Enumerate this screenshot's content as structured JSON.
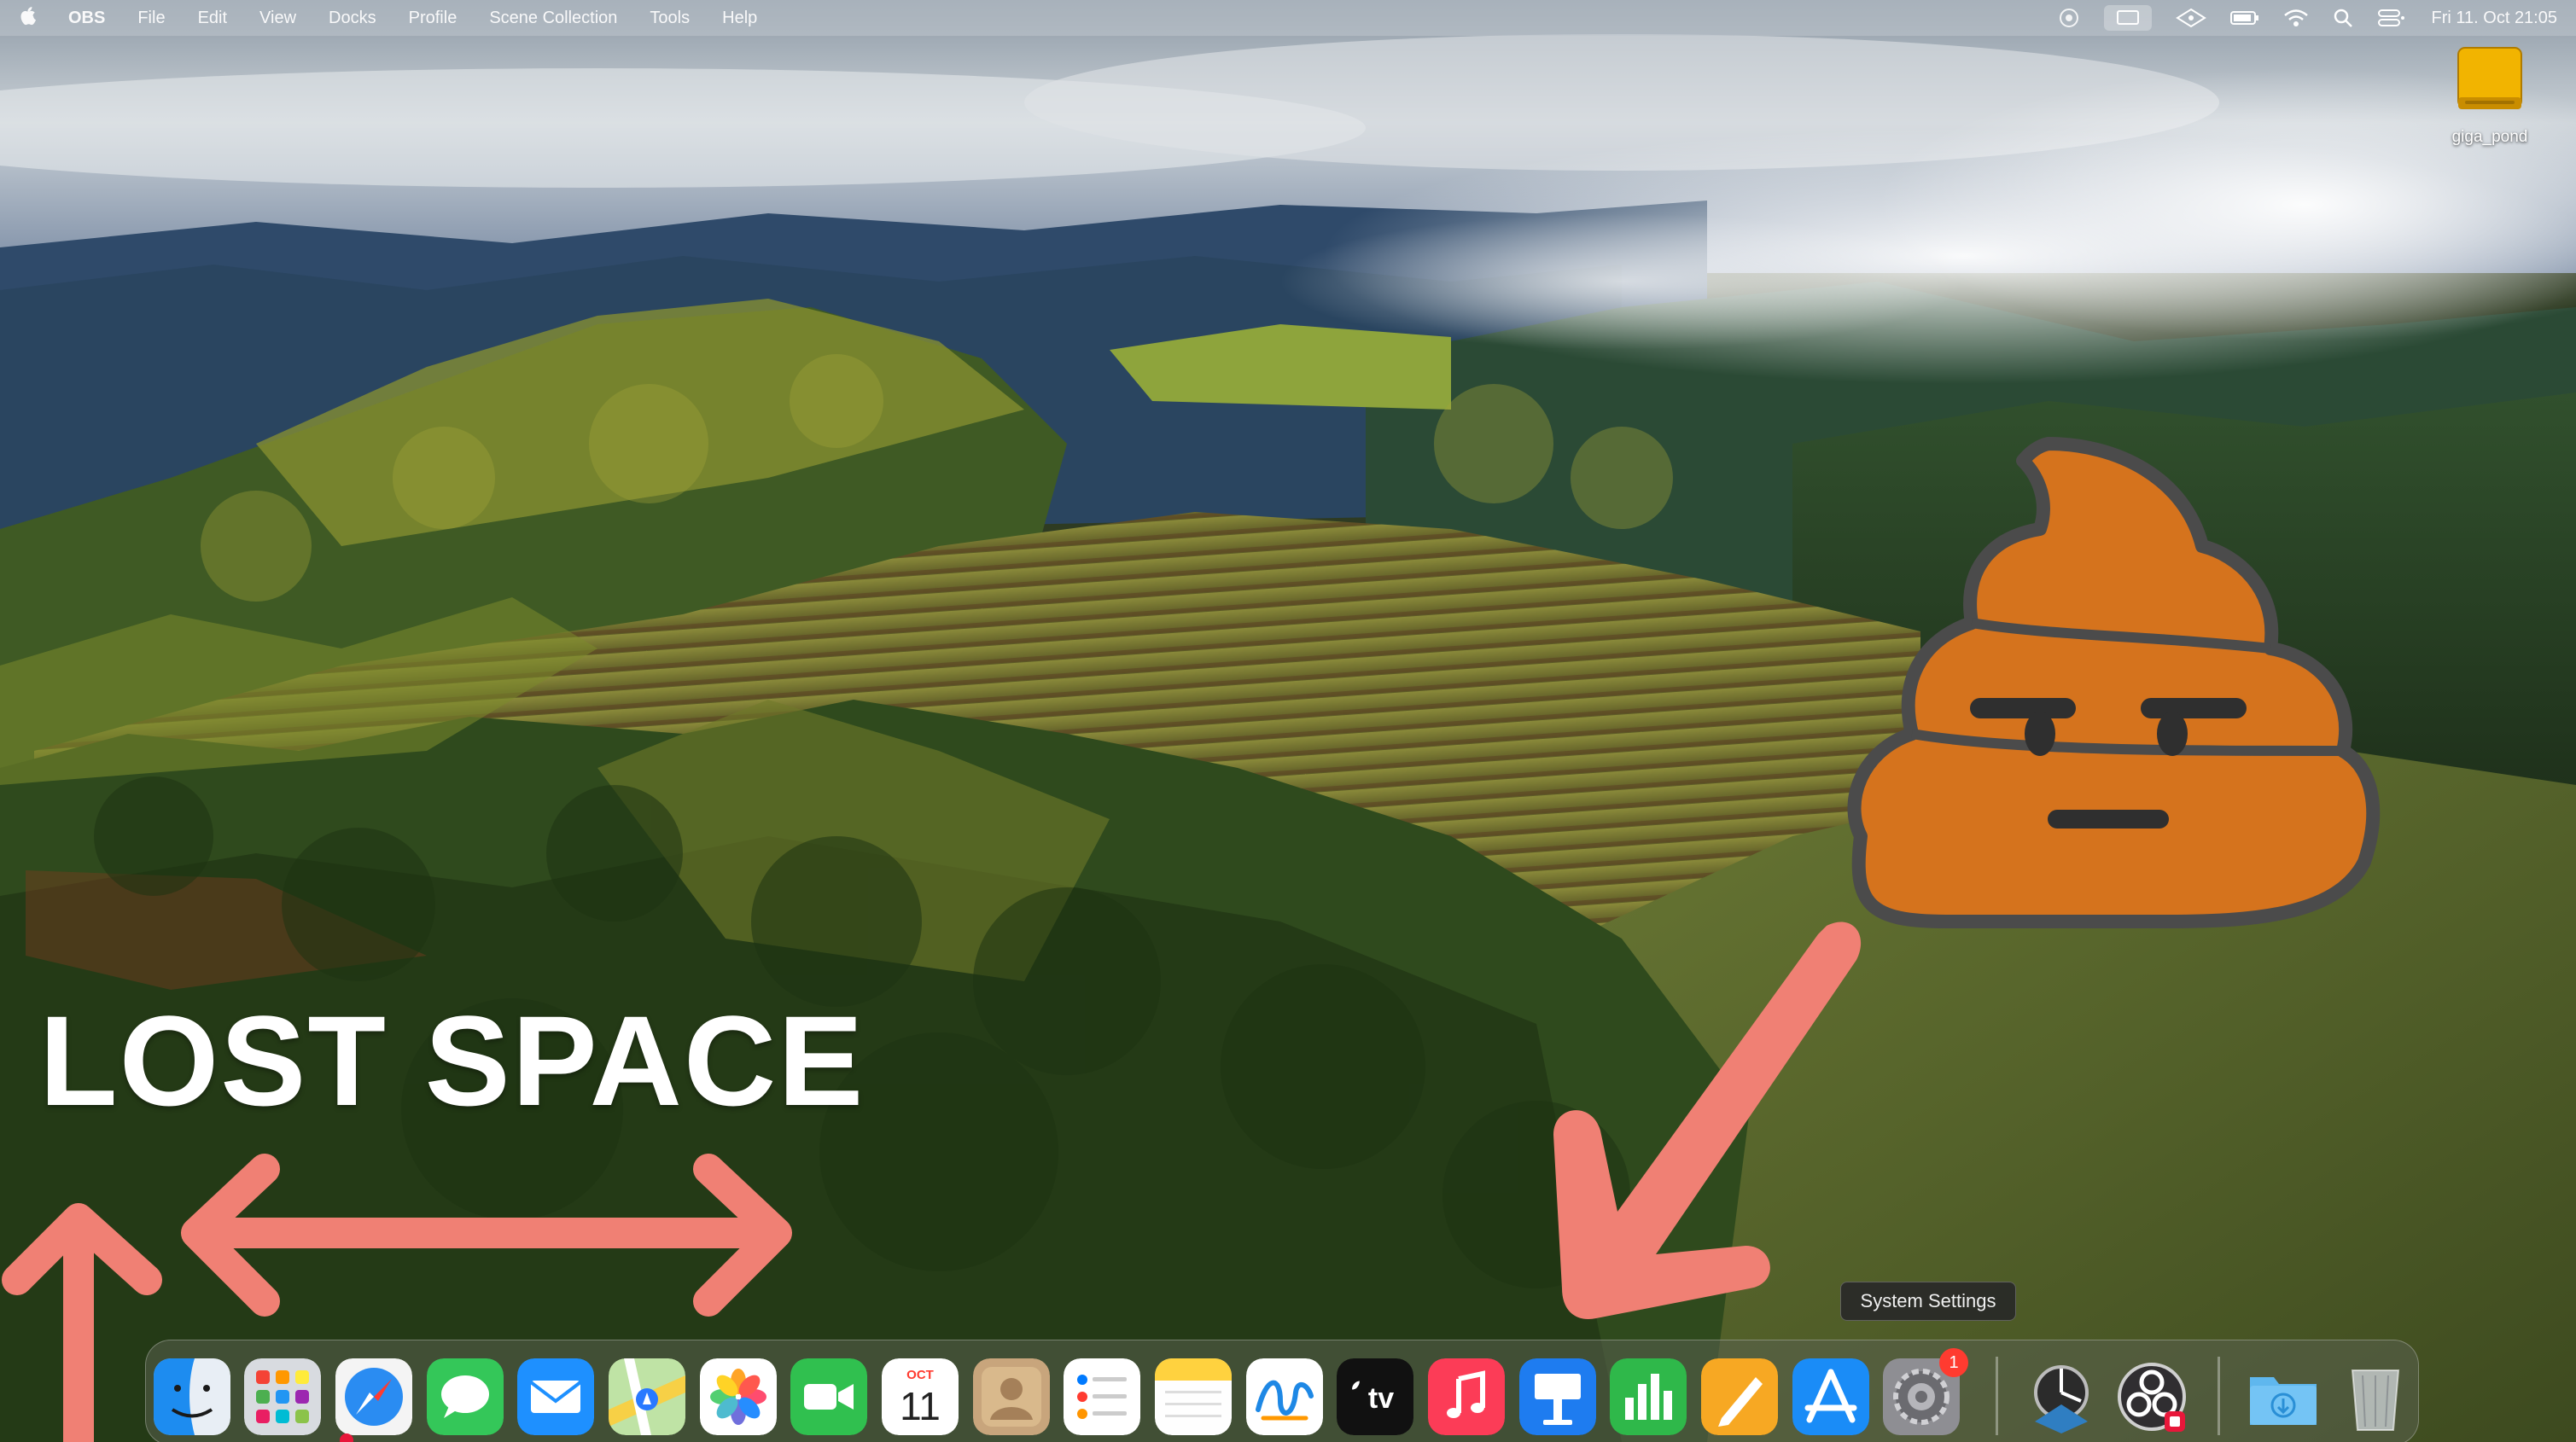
{
  "menubar": {
    "app_name": "OBS",
    "menus": [
      "File",
      "Edit",
      "View",
      "Docks",
      "Profile",
      "Scene Collection",
      "Tools",
      "Help"
    ],
    "clock": "Fri 11. Oct 21:05",
    "tray_icons": [
      "obs-status-icon",
      "screen-mirror-icon",
      "layers-icon",
      "battery-icon",
      "wifi-icon",
      "spotlight-icon",
      "control-center-icon"
    ]
  },
  "desktop": {
    "drive_label": "giga_pond",
    "drive_color": "#f2b400"
  },
  "overlay": {
    "headline": "LOST SPACE",
    "arrow_color": "#f08074",
    "emoji_icon": "poop-emoji-icon",
    "emoji_color": "#d5731d"
  },
  "tooltip": {
    "text": "System Settings"
  },
  "dock": {
    "apps": [
      {
        "name": "Finder",
        "icon": "finder-icon"
      },
      {
        "name": "Launchpad",
        "icon": "launchpad-icon"
      },
      {
        "name": "Safari",
        "icon": "safari-icon"
      },
      {
        "name": "Messages",
        "icon": "messages-icon"
      },
      {
        "name": "Mail",
        "icon": "mail-icon"
      },
      {
        "name": "Maps",
        "icon": "maps-icon"
      },
      {
        "name": "Photos",
        "icon": "photos-icon"
      },
      {
        "name": "FaceTime",
        "icon": "facetime-icon"
      },
      {
        "name": "Calendar",
        "icon": "calendar-icon",
        "month": "OCT",
        "day": "11"
      },
      {
        "name": "Contacts",
        "icon": "contacts-icon"
      },
      {
        "name": "Reminders",
        "icon": "reminders-icon"
      },
      {
        "name": "Notes",
        "icon": "notes-icon"
      },
      {
        "name": "Freeform",
        "icon": "freeform-icon"
      },
      {
        "name": "TV",
        "icon": "apple-tv-icon",
        "label": "tv"
      },
      {
        "name": "Music",
        "icon": "music-icon"
      },
      {
        "name": "Keynote",
        "icon": "keynote-icon"
      },
      {
        "name": "Numbers",
        "icon": "numbers-icon"
      },
      {
        "name": "Pages",
        "icon": "pages-icon"
      },
      {
        "name": "App Store",
        "icon": "app-store-icon"
      },
      {
        "name": "System Settings",
        "icon": "system-settings-icon",
        "badge": "1"
      },
      {
        "name": "Network Radar",
        "icon": "radar-icon"
      },
      {
        "name": "OBS",
        "icon": "obs-icon"
      },
      {
        "name": "Downloads",
        "icon": "downloads-folder-icon"
      },
      {
        "name": "Trash",
        "icon": "trash-icon"
      }
    ]
  }
}
